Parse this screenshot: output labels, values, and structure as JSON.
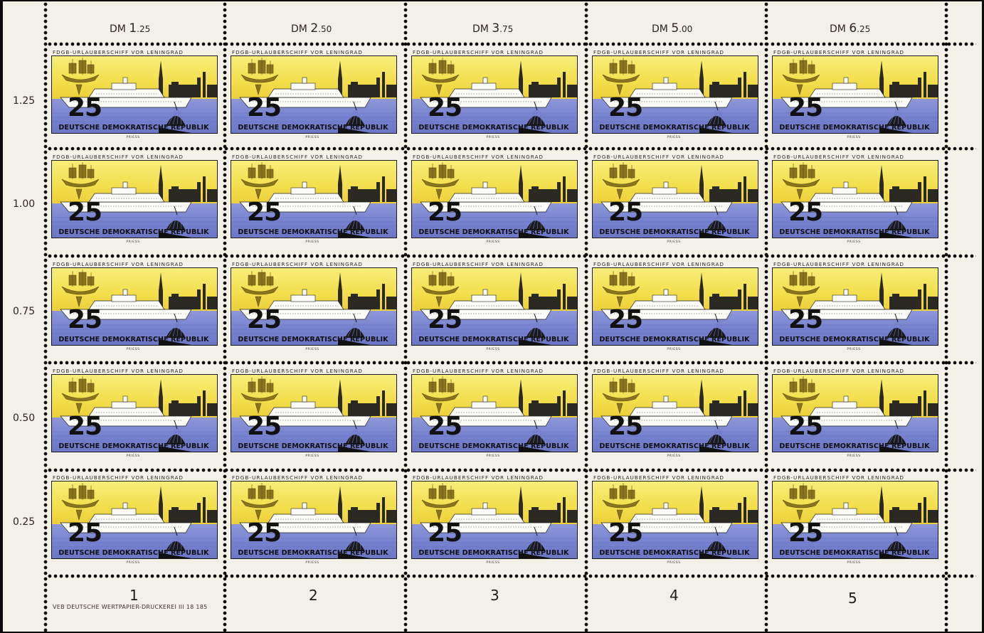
{
  "sheet": {
    "top_margin_values": [
      {
        "prefix": "DM",
        "major": "1",
        "minor": ".25"
      },
      {
        "prefix": "DM",
        "major": "2",
        "minor": ".50"
      },
      {
        "prefix": "DM",
        "major": "3",
        "minor": ".75"
      },
      {
        "prefix": "DM",
        "major": "5",
        "minor": ".00"
      },
      {
        "prefix": "DM",
        "major": "6",
        "minor": ".25"
      }
    ],
    "row_values": [
      "1.25",
      "1.00",
      "0.75",
      "0.50",
      "0.25"
    ],
    "column_numbers": [
      "1",
      "2",
      "3",
      "4",
      "5"
    ],
    "imprint": "VEB  DEUTSCHE  WERTPAPIER-DRUCKEREI    III 18 185"
  },
  "stamp": {
    "caption": "FDGB-URLAUBERSCHIFF VOR LENINGRAD",
    "value": "25",
    "country": "DEUTSCHE DEMOKRATISCHE REPUBLIK",
    "designer": "PRIESS",
    "count": 25
  },
  "colors": {
    "sky": "#f3de4c",
    "water": "#7682cf",
    "paper": "#f3f0e8",
    "background": "#0b0b0b",
    "emblem": "#8a7420"
  }
}
